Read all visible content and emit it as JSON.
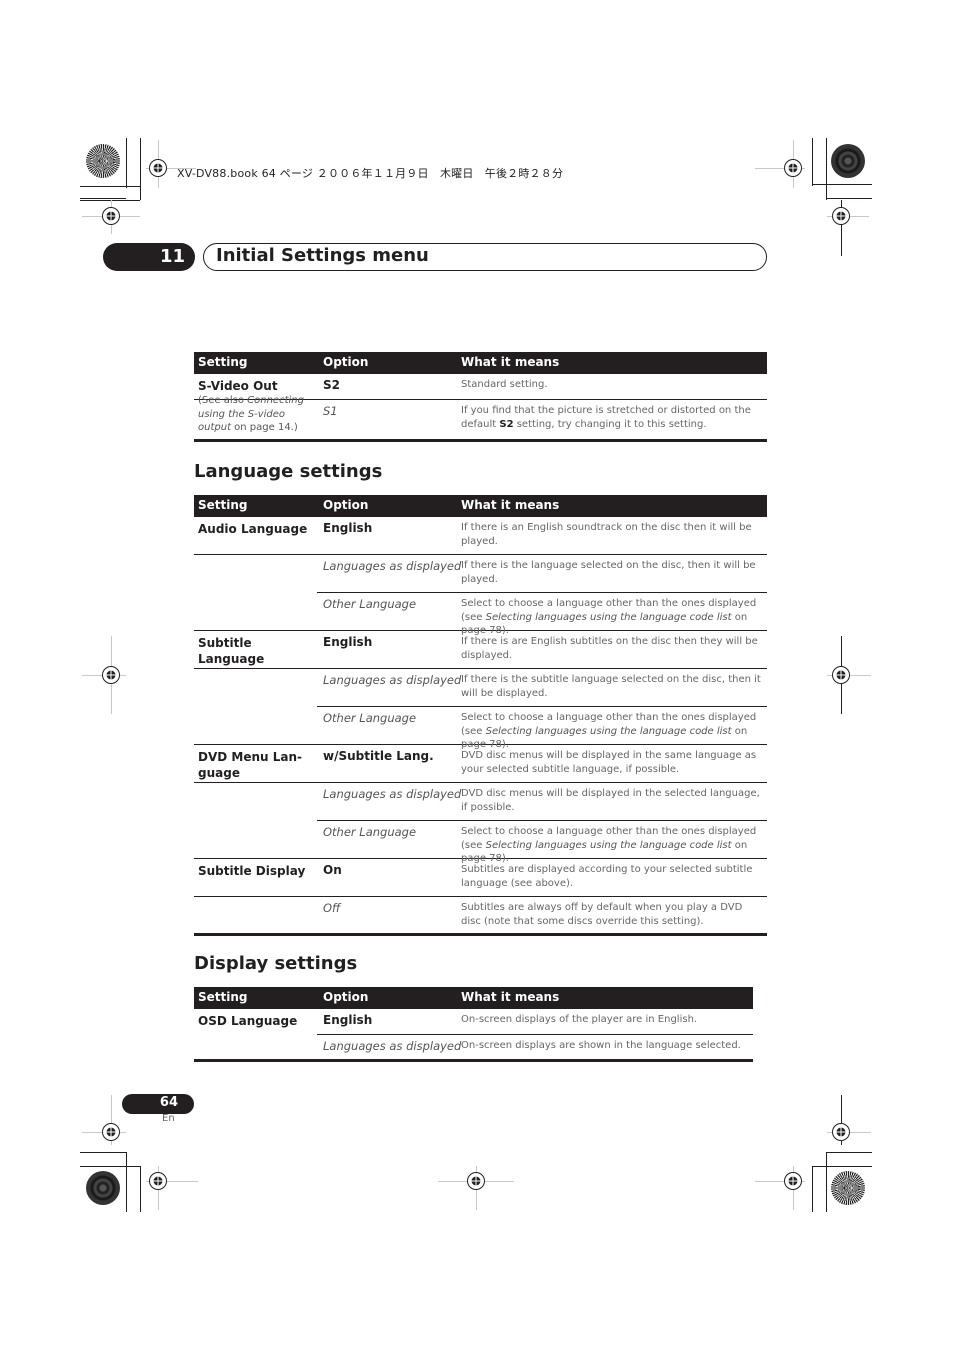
{
  "print_header": "XV-DV88.book  64 ページ  ２００６年１１月９日　木曜日　午後２時２８分",
  "chapter": {
    "number": "11",
    "title": "Initial Settings menu"
  },
  "table_headers": {
    "setting": "Setting",
    "option": "Option",
    "meaning": "What it means"
  },
  "video_table": {
    "rows": [
      {
        "setting": "S-Video Out",
        "note_prefix": "(See also ",
        "note_italic": "Connecting using the S-video output",
        "note_suffix": " on page 14.)",
        "options": [
          {
            "option": "S2",
            "style": "bold",
            "meaning": "Standard setting."
          },
          {
            "option": "S1",
            "style": "italic",
            "meaning_prefix": "If you find that the picture is stretched or distorted on the default ",
            "meaning_bold": "S2",
            "meaning_suffix": " setting, try changing it to this setting."
          }
        ]
      }
    ]
  },
  "language_section": {
    "title": "Language settings",
    "rows": [
      {
        "setting": "Audio Language",
        "options": [
          {
            "option": "English",
            "style": "bold",
            "meaning": "If there is an English soundtrack on the disc then it will be played."
          },
          {
            "option": "Languages as displayed",
            "style": "italic",
            "meaning": "If there is the language selected on the disc, then it will be played."
          },
          {
            "option": "Other Language",
            "style": "italic",
            "meaning_prefix": "Select to choose a language other than the ones displayed (see ",
            "meaning_italic": "Selecting languages using the language code list",
            "meaning_suffix": " on page 78)."
          }
        ]
      },
      {
        "setting": "Subtitle Language",
        "options": [
          {
            "option": "English",
            "style": "bold",
            "meaning": "If there is are English subtitles on the disc then they will be displayed."
          },
          {
            "option": "Languages as displayed",
            "style": "italic",
            "meaning": "If there is the subtitle language selected on the disc, then it will be displayed."
          },
          {
            "option": "Other Language",
            "style": "italic",
            "meaning_prefix": "Select to choose a language other than the ones displayed (see ",
            "meaning_italic": "Selecting languages using the language code list",
            "meaning_suffix": " on page 78)."
          }
        ]
      },
      {
        "setting": "DVD Menu Lan-\nguage",
        "options": [
          {
            "option": "w/Subtitle Lang.",
            "style": "bold",
            "meaning": "DVD disc menus will be displayed in the same language as your selected subtitle language, if possible."
          },
          {
            "option": "Languages as displayed",
            "style": "italic",
            "meaning": "DVD disc menus will be displayed in the selected language, if possible."
          },
          {
            "option": "Other Language",
            "style": "italic",
            "meaning_prefix": "Select to choose a language other than the ones displayed (see ",
            "meaning_italic": "Selecting languages using the language code list",
            "meaning_suffix": " on page 78)."
          }
        ]
      },
      {
        "setting": "Subtitle Display",
        "options": [
          {
            "option": "On",
            "style": "bold",
            "meaning": "Subtitles are displayed according to your selected subtitle language (see above)."
          },
          {
            "option": "Off",
            "style": "italic",
            "meaning": "Subtitles are always off by default when you play a DVD disc (note that some discs override this setting)."
          }
        ]
      }
    ]
  },
  "display_section": {
    "title": "Display settings",
    "rows": [
      {
        "setting": "OSD Language",
        "options": [
          {
            "option": "English",
            "style": "bold",
            "meaning": "On-screen displays of the player are in English."
          },
          {
            "option": "Languages as displayed",
            "style": "italic",
            "meaning": "On-screen displays are shown in the language selected."
          }
        ]
      }
    ]
  },
  "footer": {
    "page_number": "64",
    "language": "En"
  }
}
